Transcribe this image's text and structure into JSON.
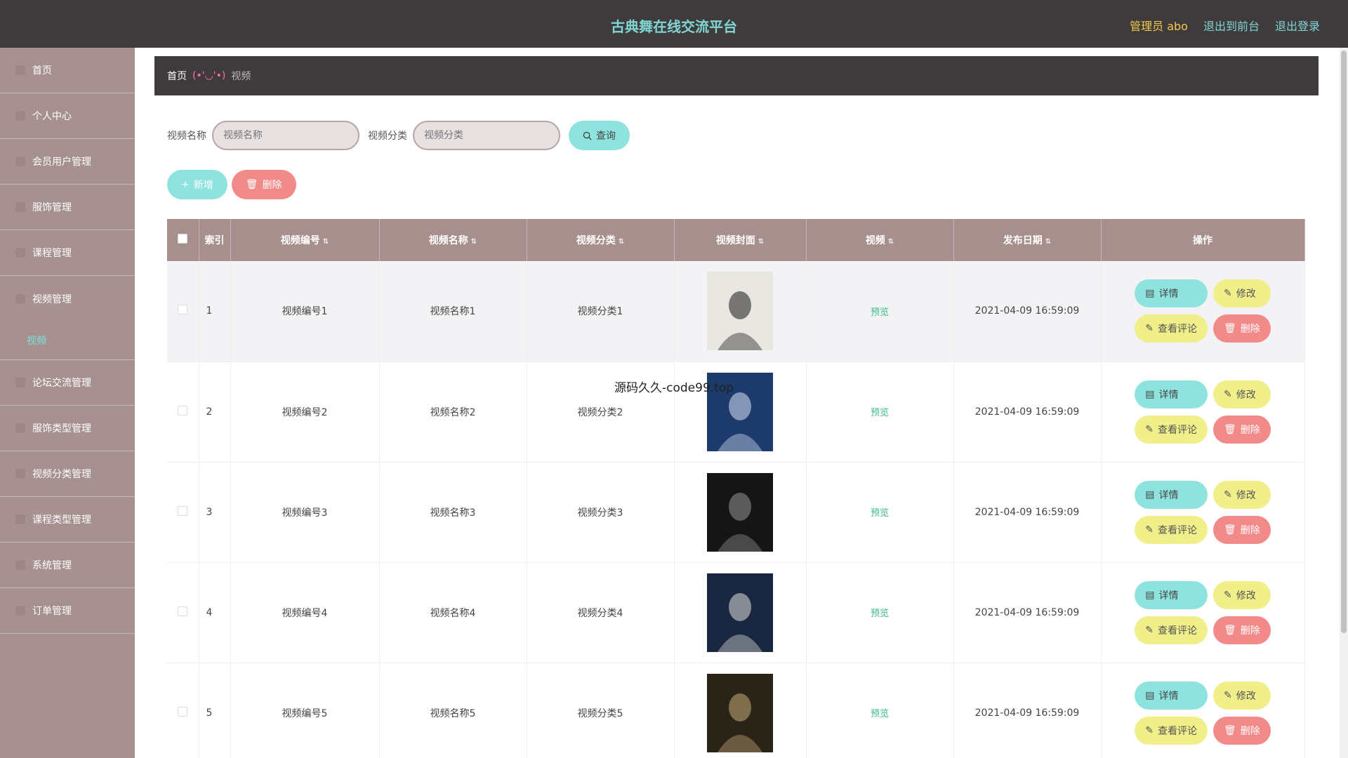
{
  "header": {
    "title": "古典舞在线交流平台",
    "admin": "管理员 abo",
    "back_front": "退出到前台",
    "logout": "退出登录"
  },
  "sidebar": {
    "items": [
      {
        "label": "首页"
      },
      {
        "label": "个人中心"
      },
      {
        "label": "会员用户管理"
      },
      {
        "label": "服饰管理"
      },
      {
        "label": "课程管理"
      },
      {
        "label": "视频管理"
      },
      {
        "label": "论坛交流管理"
      },
      {
        "label": "服饰类型管理"
      },
      {
        "label": "视频分类管理"
      },
      {
        "label": "课程类型管理"
      },
      {
        "label": "系统管理"
      },
      {
        "label": "订单管理"
      }
    ],
    "sub_active": "视频"
  },
  "breadcrumb": {
    "home": "首页",
    "separator": "(•'◡'•)",
    "current": "视频"
  },
  "search": {
    "name_label": "视频名称",
    "name_placeholder": "视频名称",
    "category_label": "视频分类",
    "category_placeholder": "视频分类",
    "query_button": "查询"
  },
  "toolbar": {
    "add": "新增",
    "delete": "删除"
  },
  "table": {
    "headers": {
      "index": "索引",
      "code": "视频编号",
      "name": "视频名称",
      "category": "视频分类",
      "cover": "视频封面",
      "video": "视频",
      "date": "发布日期",
      "ops": "操作"
    },
    "rows": [
      {
        "index": "1",
        "code": "视频编号1",
        "name": "视频名称1",
        "category": "视频分类1",
        "video": "预览",
        "date": "2021-04-09 16:59:09"
      },
      {
        "index": "2",
        "code": "视频编号2",
        "name": "视频名称2",
        "category": "视频分类2",
        "video": "预览",
        "date": "2021-04-09 16:59:09"
      },
      {
        "index": "3",
        "code": "视频编号3",
        "name": "视频名称3",
        "category": "视频分类3",
        "video": "预览",
        "date": "2021-04-09 16:59:09"
      },
      {
        "index": "4",
        "code": "视频编号4",
        "name": "视频名称4",
        "category": "视频分类4",
        "video": "预览",
        "date": "2021-04-09 16:59:09"
      },
      {
        "index": "5",
        "code": "视频编号5",
        "name": "视频名称5",
        "category": "视频分类5",
        "video": "预览",
        "date": "2021-04-09 16:59:09"
      }
    ],
    "row_actions": {
      "detail": "详情",
      "edit": "修改",
      "comments": "查看评论",
      "delete": "删除"
    }
  },
  "overlay_text": "源码久久-code99.top",
  "colors": {
    "topbar": "#3f3b3c",
    "sidebar": "#a69090",
    "accent_cyan": "#8fe3df",
    "accent_red": "#f28a8a",
    "accent_yellow": "#f1ef8a",
    "title": "#7fd6d3"
  }
}
